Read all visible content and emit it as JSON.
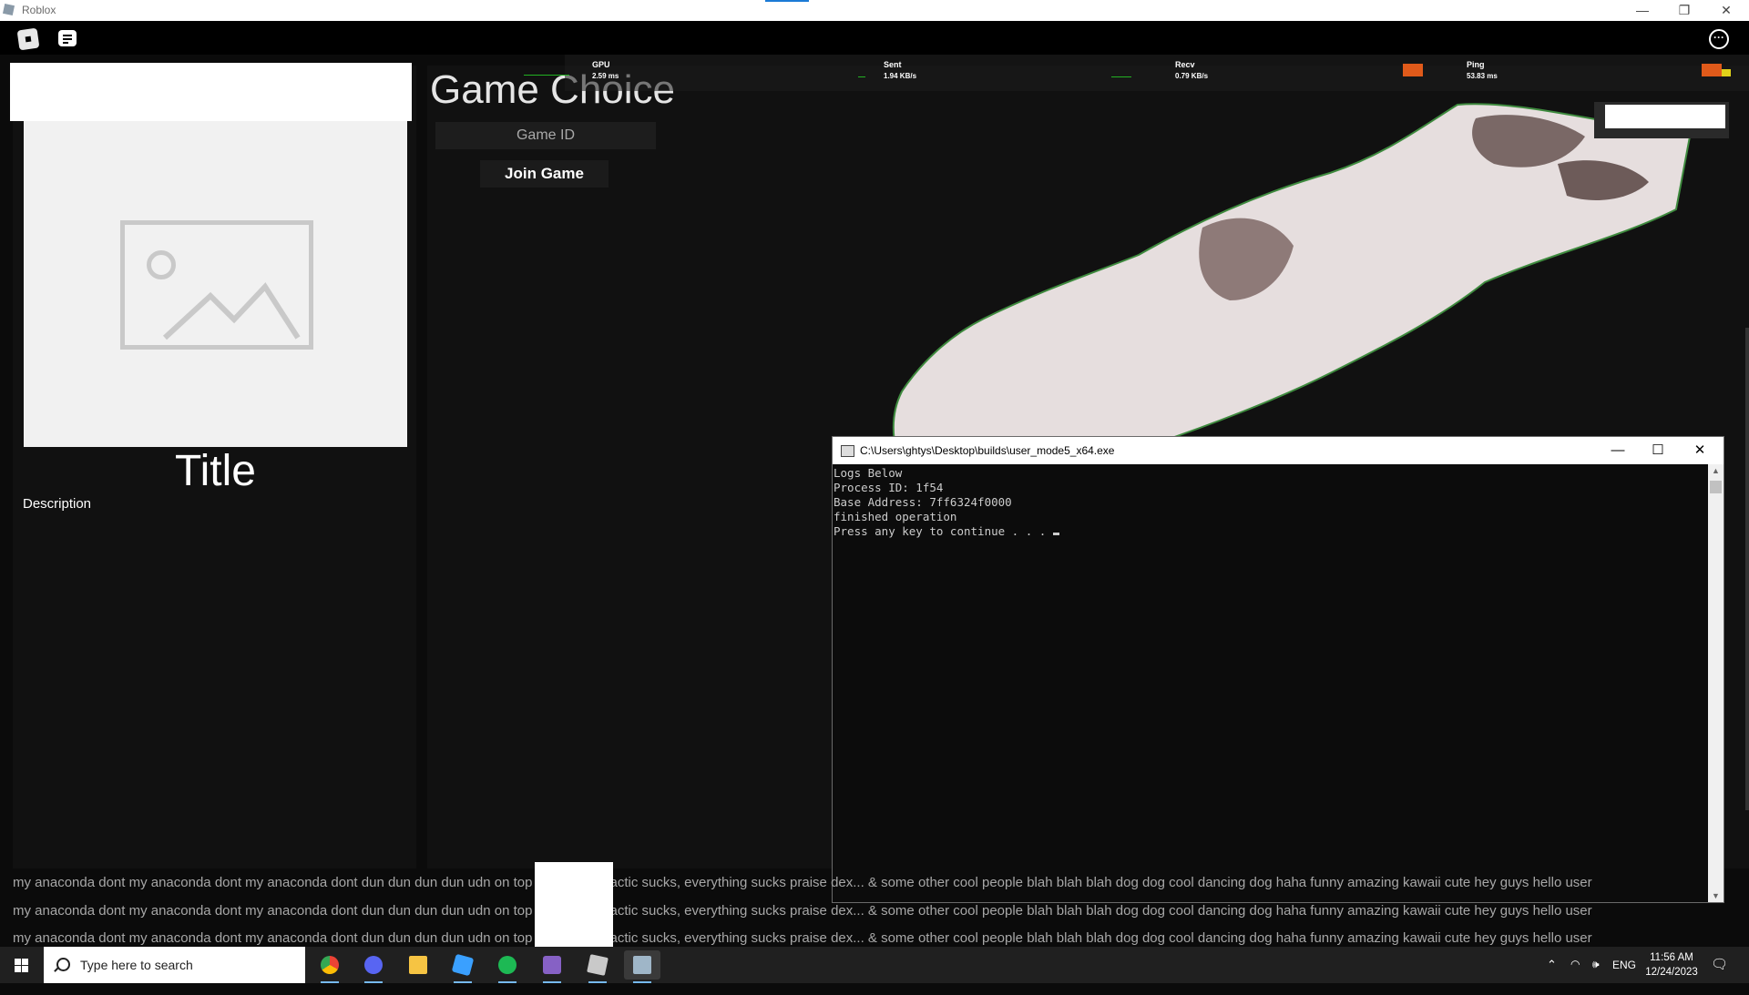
{
  "window": {
    "title": "Roblox",
    "minimize_glyph": "—",
    "restore_glyph": "❐",
    "close_glyph": "✕"
  },
  "topbar": {
    "menu_icon": "roblox-menu-icon",
    "chat_icon": "chat-icon",
    "more_glyph": "···"
  },
  "stats": {
    "gpu": {
      "label": "GPU",
      "value": "2.59 ms"
    },
    "sent": {
      "label": "Sent",
      "value": "1.94 KB/s"
    },
    "recv": {
      "label": "Recv",
      "value": "0.79 KB/s"
    },
    "ping": {
      "label": "Ping",
      "value": "53.83 ms"
    }
  },
  "left_panel": {
    "title": "Title",
    "description": "Description"
  },
  "main": {
    "heading": "Game Choice",
    "game_id_placeholder": "Game ID",
    "join_button": "Join Game"
  },
  "console": {
    "title": "C:\\Users\\ghtys\\Desktop\\builds\\user_mode5_x64.exe",
    "lines": [
      "Logs Below",
      "Process ID: 1f54",
      "Base Address: 7ff6324f0000",
      "finished operation",
      "Press any key to continue . . . "
    ],
    "minimize_glyph": "—",
    "maximize_glyph": "☐",
    "close_glyph": "✕"
  },
  "ticker": {
    "line1": "my anaconda dont my anaconda dont my anaconda dont dun dun dun dun udn on top rune sucks, actic sucks, everything sucks praise dex... & some other cool people blah blah blah dog dog cool dancing dog haha funny amazing kawaii cute hey guys hello user",
    "line2": "my anaconda dont my anaconda dont my anaconda dont dun dun dun dun udn on top rune sucks, actic sucks, everything sucks praise dex... & some other cool people blah blah blah dog dog cool dancing dog haha funny amazing kawaii cute hey guys hello user",
    "line3": "my anaconda dont my anaconda dont my anaconda dont dun dun dun dun udn on top rune sucks, actic sucks, everything sucks praise dex... & some other cool people blah blah blah dog dog cool dancing dog haha funny amazing kawaii cute hey guys hello user"
  },
  "taskbar": {
    "search_placeholder": "Type here to search",
    "apps": [
      "chrome-icon",
      "discord-icon",
      "file-explorer-icon",
      "roblox-studio-icon",
      "spotify-icon",
      "visual-studio-icon",
      "roblox-icon",
      "console-icon"
    ],
    "language": "ENG",
    "time": "11:56 AM",
    "date": "12/24/2023",
    "colors": {
      "chrome": "#ea4335",
      "discord": "#5865f2",
      "explorer": "#f6c443",
      "studio": "#3aa0ff",
      "spotify": "#1db954",
      "vs": "#8661c5"
    }
  }
}
